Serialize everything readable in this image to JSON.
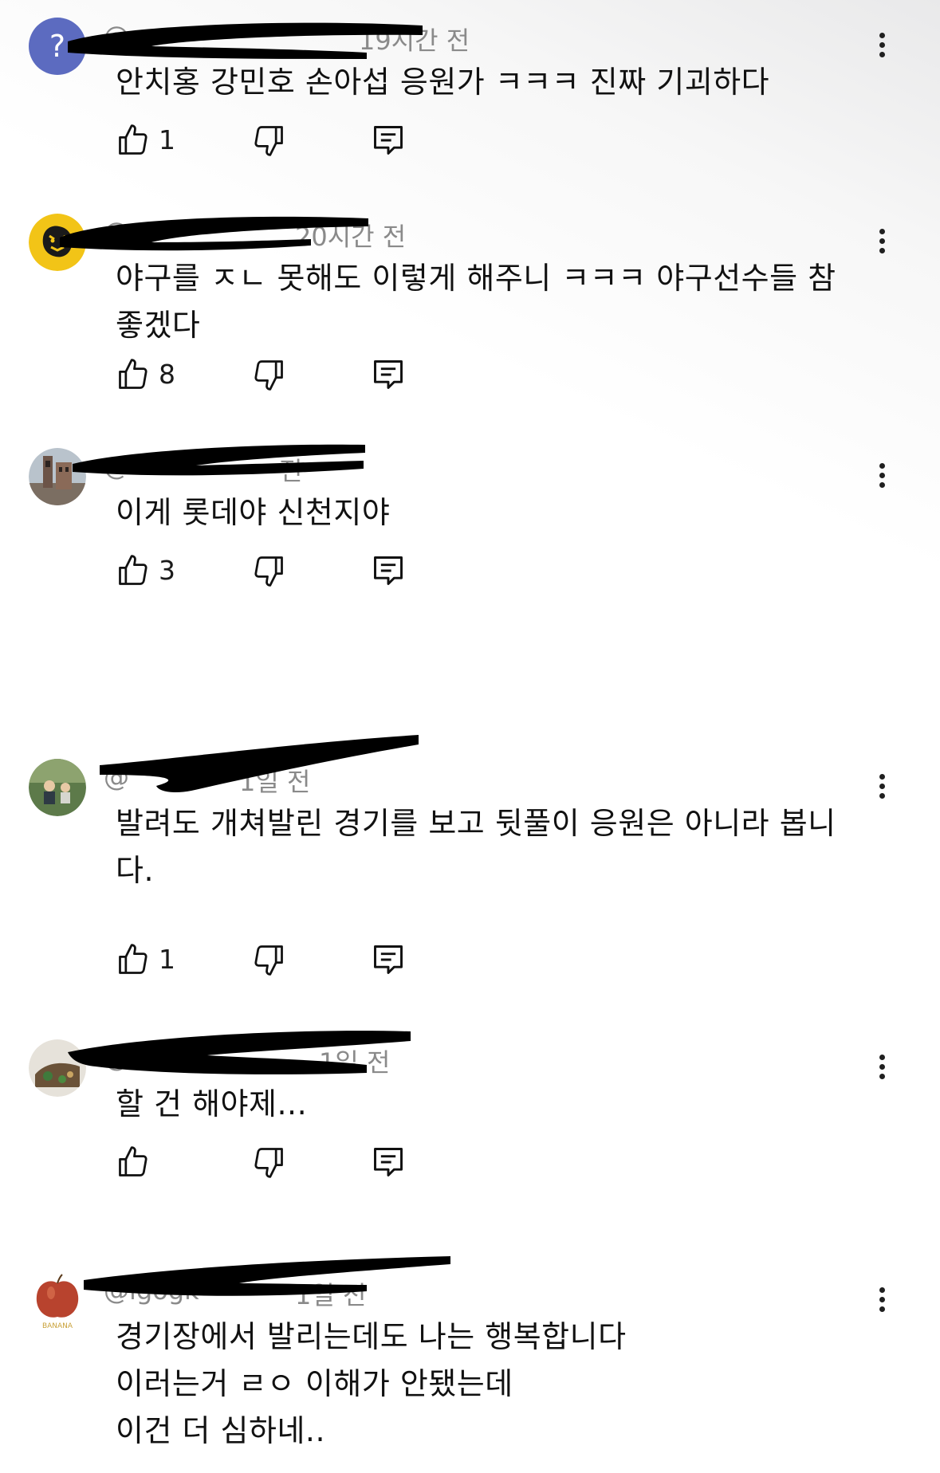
{
  "comments": [
    {
      "avatar_icon": "question-mark-avatar-icon",
      "avatar_glyph": "?",
      "handle": "@",
      "time": "19시간 전",
      "lines": [
        "안치홍 강민호 손아섭 응원가 ㅋㅋㅋ 진짜 기괴하다"
      ],
      "likes": "1"
    },
    {
      "avatar_icon": "tiger-avatar-icon",
      "handle": "@",
      "time": "20시간 전",
      "lines": [
        "야구를 ㅈㄴ 못해도 이렇게 해주니 ㅋㅋㅋ  야구선수들 참",
        "좋겠다"
      ],
      "likes": "8"
    },
    {
      "avatar_icon": "building-avatar-icon",
      "handle": "@",
      "time": "전",
      "lines": [
        "이게 롯데야 신천지야"
      ],
      "likes": "3"
    },
    {
      "avatar_icon": "people-avatar-icon",
      "handle": "@",
      "time": "1일 전",
      "lines": [
        "발려도 개쳐발린 경기를 보고 뒷풀이 응원은 아니라 봅니",
        "다."
      ],
      "likes": "1"
    },
    {
      "avatar_icon": "food-avatar-icon",
      "handle": "@",
      "time": "1일 전",
      "lines": [
        "할 건 해야제..."
      ],
      "likes": ""
    },
    {
      "avatar_icon": "apple-avatar-icon",
      "handle": "@igogk",
      "time": "1일 전",
      "lines": [
        "경기장에서 발리는데도 나는 행복합니다",
        "이러는거 ㄹㅇ 이해가 안됐는데",
        "이건 더 심하네.."
      ],
      "likes": ""
    }
  ],
  "icons": {
    "like": "thumbs-up-icon",
    "dislike": "thumbs-down-icon",
    "reply": "reply-comment-icon",
    "more": "more-vertical-icon"
  },
  "colors": {
    "meta_text": "#8a8a8a",
    "body_text": "#111111",
    "redaction": "#000000",
    "avatar_q_bg": "#5c6bc0"
  }
}
